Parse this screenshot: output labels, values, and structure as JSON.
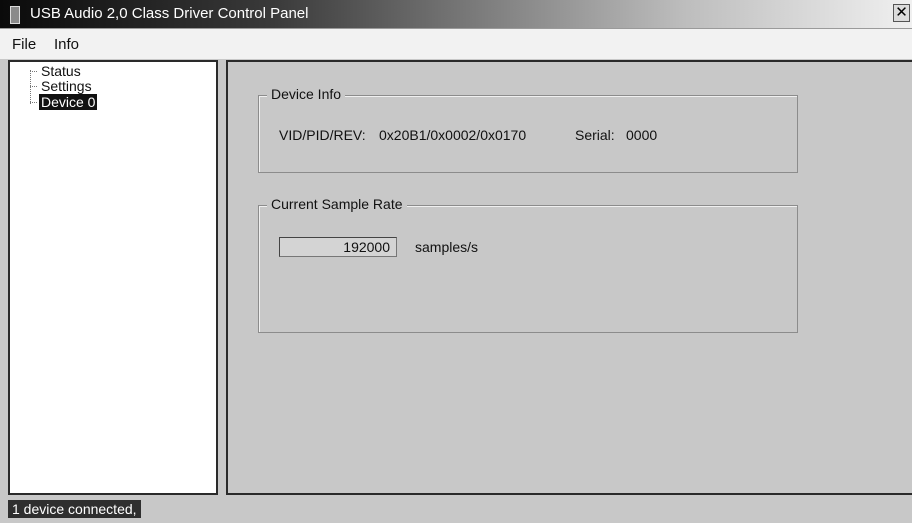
{
  "window": {
    "title": "USB Audio 2,0 Class Driver Control Panel",
    "close_glyph": "✕"
  },
  "menu": {
    "items": [
      {
        "label": "File"
      },
      {
        "label": "Info"
      }
    ]
  },
  "tree": {
    "items": [
      {
        "label": "Status",
        "selected": false
      },
      {
        "label": "Settings",
        "selected": false
      },
      {
        "label": "Device 0",
        "selected": true
      }
    ]
  },
  "device_info": {
    "title": "Device Info",
    "vidpid_label": "VID/PID/REV:",
    "vidpid_value": "0x20B1/0x0002/0x0170",
    "serial_label": "Serial:",
    "serial_value": "0000"
  },
  "sample_rate": {
    "title": "Current Sample Rate",
    "value": "192000",
    "unit": "samples/s"
  },
  "status": {
    "text": "1 device connected,"
  },
  "icons": {
    "app": "app-icon",
    "close": "close-icon"
  }
}
